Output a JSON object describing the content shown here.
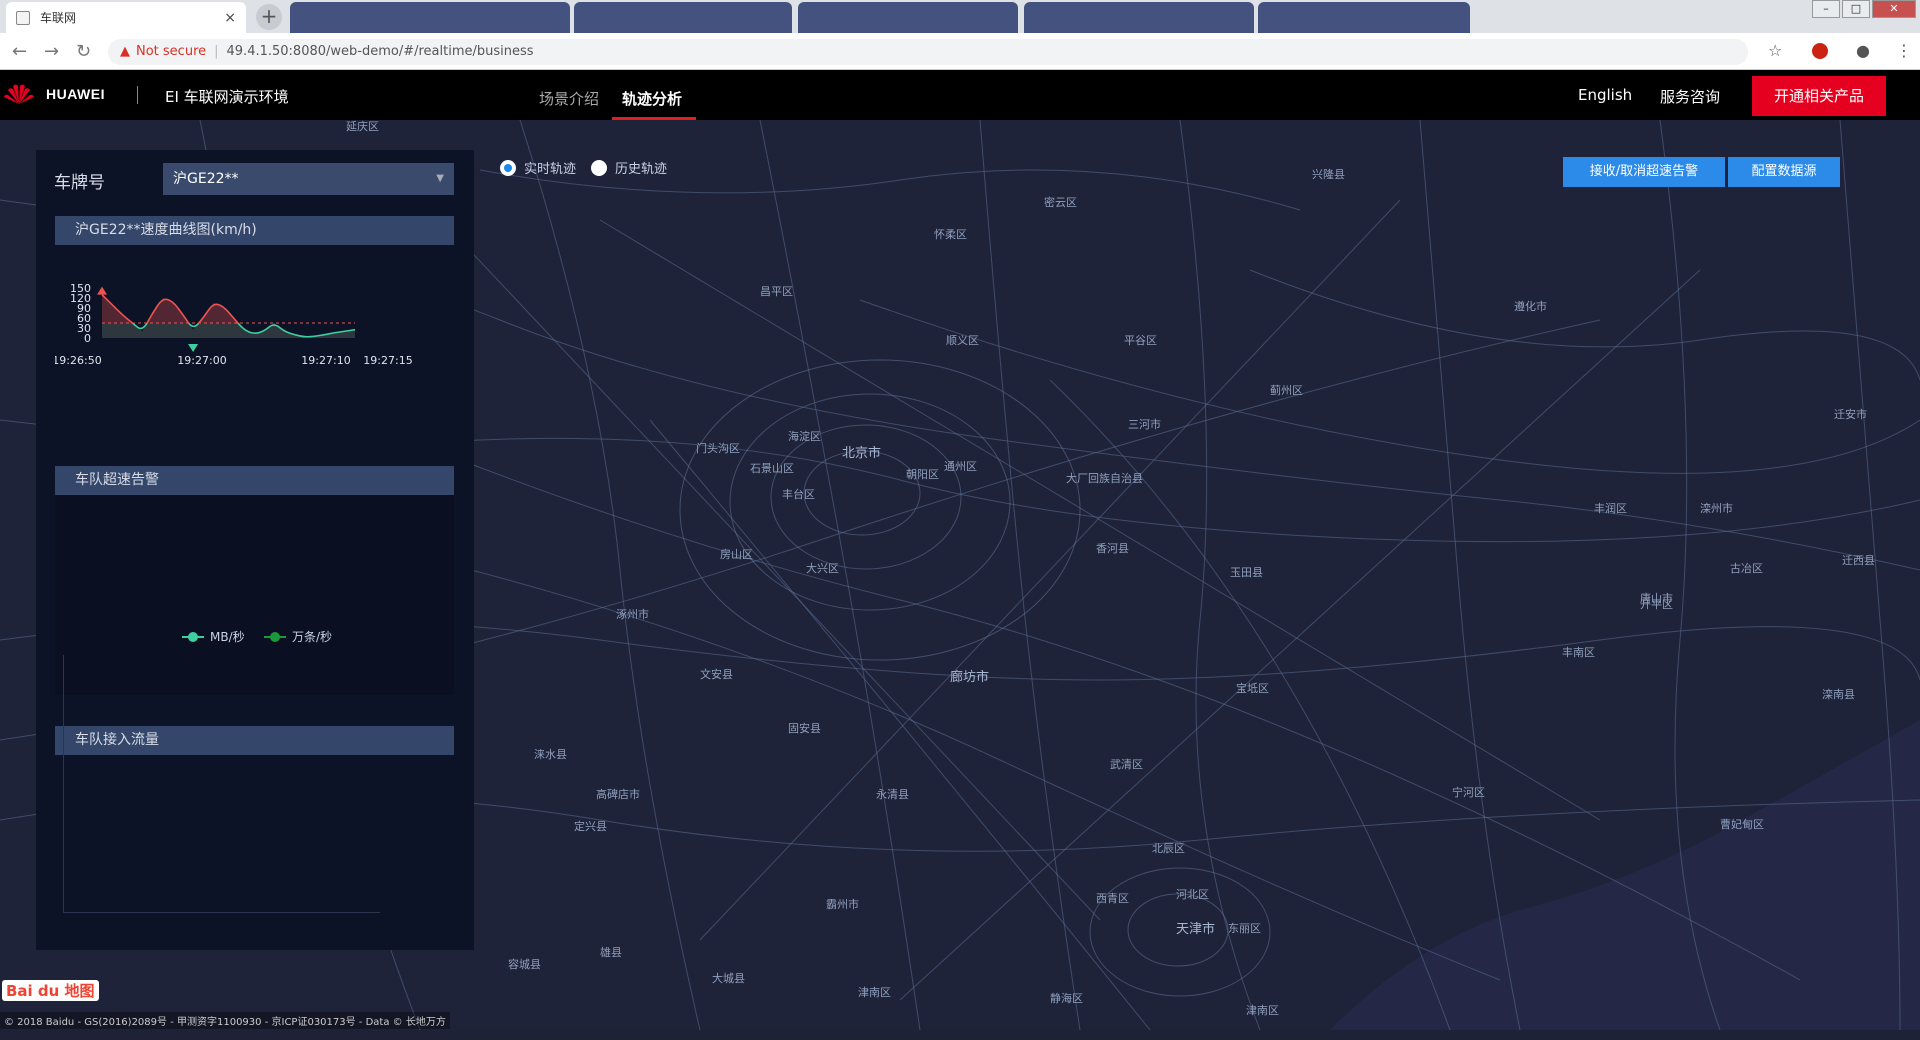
{
  "browser": {
    "tab_title": "车联网",
    "tab_close": "×",
    "new_tab": "+",
    "nav_back": "←",
    "nav_forward": "→",
    "nav_reload": "↻",
    "security_icon": "▲",
    "security_text": "Not secure",
    "url": "49.4.1.50:8080/web-demo/#/realtime/business",
    "bookmark_icon": "☆",
    "menu_icon": "⋮",
    "account_icon": "●"
  },
  "window_controls": {
    "minimize": "–",
    "maximize": "□",
    "close": "✕"
  },
  "header": {
    "brand": "HUAWEI",
    "app_title": "EI 车联网演示环境",
    "tabs": [
      {
        "label": "场景介绍",
        "active": false
      },
      {
        "label": "轨迹分析",
        "active": true
      }
    ],
    "language": "English",
    "consult": "服务咨询",
    "cta": "开通相关产品"
  },
  "map_controls": {
    "modes": [
      {
        "label": "实时轨迹",
        "checked": true
      },
      {
        "label": "历史轨迹",
        "checked": false
      }
    ],
    "alarm_button": "接收/取消超速告警",
    "datasource_button": "配置数据源"
  },
  "panel": {
    "plate_label": "车牌号",
    "plate_value": "沪GE22**",
    "speed_title": "沪GE22**速度曲线图(km/h)",
    "alarm_title": "车队超速告警",
    "flow_title": "车队接入流量",
    "flow_legend": [
      {
        "label": "MB/秒",
        "color": "#3ecfa0"
      },
      {
        "label": "万条/秒",
        "color": "#1a9a3a"
      }
    ]
  },
  "chart_data": {
    "type": "line",
    "title": "沪GE22**速度曲线图(km/h)",
    "x_tick_labels": [
      "19:26:50",
      "19:27:00",
      "19:27:10",
      "19:27:15"
    ],
    "y_ticks": [
      0,
      30,
      60,
      90,
      120,
      150
    ],
    "ylim": [
      0,
      150
    ],
    "threshold": 45,
    "series": [
      {
        "values": [
          130,
          100,
          70,
          45,
          20,
          75,
          120,
          110,
          70,
          25,
          60,
          105,
          95,
          60,
          25,
          12,
          20,
          45,
          20,
          10,
          3,
          5,
          10,
          16,
          20,
          25
        ]
      }
    ],
    "colors": {
      "above": "#ef5350",
      "below": "#3ecfa0",
      "threshold": "#ef5350"
    }
  },
  "map": {
    "labels": [
      "北京市",
      "昌平区",
      "顺义区",
      "怀柔区",
      "密云区",
      "平谷区",
      "兴隆县",
      "迁安市",
      "遵化市",
      "门头沟区",
      "海淀区",
      "石景山区",
      "丰台区",
      "朝阳区",
      "通州区",
      "三河市",
      "大厂回族自治县",
      "房山区",
      "大兴区",
      "香河县",
      "蓟州区",
      "玉田县",
      "丰润区",
      "丰南区",
      "滦南县",
      "迁西县",
      "涿州市",
      "固安县",
      "永清县",
      "廊坊市",
      "武清区",
      "宝坻区",
      "宁河区",
      "涞水县",
      "高碑店市",
      "定兴县",
      "霸州市",
      "雄县",
      "容城县",
      "西青区",
      "天津市",
      "东丽区",
      "津南区",
      "北辰区",
      "河北区",
      "静海区",
      "大城县",
      "文安县",
      "滦州市",
      "唐山市",
      "古冶区",
      "开平区",
      "曹妃甸区",
      "延庆区"
    ],
    "baidu_logo": "Bai du 地图",
    "copyright": "© 2018 Baidu - GS(2016)2089号 - 甲测资字1100930 - 京ICP证030173号 - Data © 长地万方"
  }
}
